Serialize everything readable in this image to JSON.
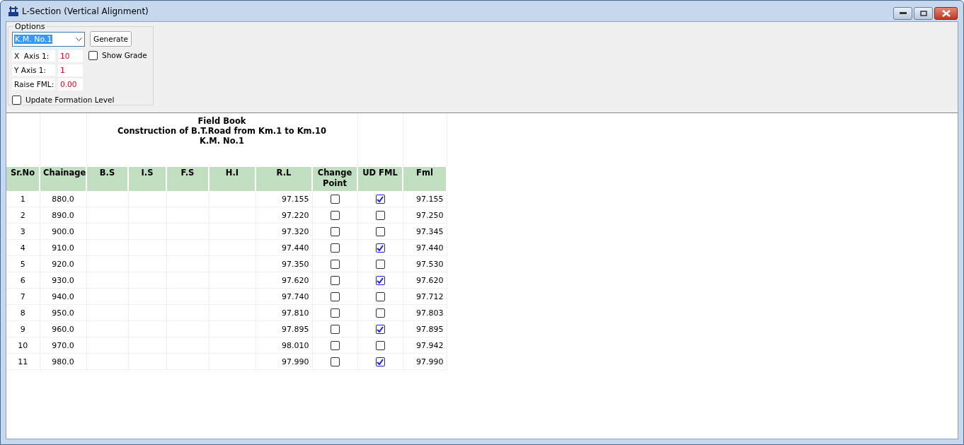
{
  "window": {
    "title": "L-Section (Vertical Alignment)"
  },
  "options": {
    "group_label": "Options",
    "dropdown": {
      "value": "K.M. No.1"
    },
    "generate_button": "Generate",
    "show_grade": {
      "label": "Show Grade",
      "checked": false
    },
    "fields": [
      {
        "label": "X  Axis 1:",
        "value": "10"
      },
      {
        "label": "Y Axis 1:",
        "value": "1"
      },
      {
        "label": "Raise FML:",
        "value": "0.00"
      }
    ],
    "update_formation_level": {
      "label": "Update Formation Level",
      "checked": false
    }
  },
  "field_book": {
    "title_lines": [
      "Field Book",
      "Construction of B.T.Road from Km.1 to Km.10",
      "K.M. No.1"
    ],
    "columns": [
      "Sr.No",
      "Chainage",
      "B.S",
      "I.S",
      "F.S",
      "H.I",
      "R.L",
      "Change Point",
      "UD FML",
      "Fml"
    ],
    "rows": [
      {
        "sr_no": "1",
        "chainage": "880.0",
        "rl": "97.155",
        "change_point": false,
        "ud_fml": true,
        "fml": "97.155"
      },
      {
        "sr_no": "2",
        "chainage": "890.0",
        "rl": "97.220",
        "change_point": false,
        "ud_fml": false,
        "fml": "97.250"
      },
      {
        "sr_no": "3",
        "chainage": "900.0",
        "rl": "97.320",
        "change_point": false,
        "ud_fml": false,
        "fml": "97.345"
      },
      {
        "sr_no": "4",
        "chainage": "910.0",
        "rl": "97.440",
        "change_point": false,
        "ud_fml": true,
        "fml": "97.440"
      },
      {
        "sr_no": "5",
        "chainage": "920.0",
        "rl": "97.350",
        "change_point": false,
        "ud_fml": false,
        "fml": "97.530"
      },
      {
        "sr_no": "6",
        "chainage": "930.0",
        "rl": "97.620",
        "change_point": false,
        "ud_fml": true,
        "fml": "97.620"
      },
      {
        "sr_no": "7",
        "chainage": "940.0",
        "rl": "97.740",
        "change_point": false,
        "ud_fml": false,
        "fml": "97.712"
      },
      {
        "sr_no": "8",
        "chainage": "950.0",
        "rl": "97.810",
        "change_point": false,
        "ud_fml": false,
        "fml": "97.803"
      },
      {
        "sr_no": "9",
        "chainage": "960.0",
        "rl": "97.895",
        "change_point": false,
        "ud_fml": true,
        "fml": "97.895"
      },
      {
        "sr_no": "10",
        "chainage": "970.0",
        "rl": "98.010",
        "change_point": false,
        "ud_fml": false,
        "fml": "97.942"
      },
      {
        "sr_no": "11",
        "chainage": "980.0",
        "rl": "97.990",
        "change_point": false,
        "ud_fml": true,
        "fml": "97.990"
      }
    ]
  }
}
